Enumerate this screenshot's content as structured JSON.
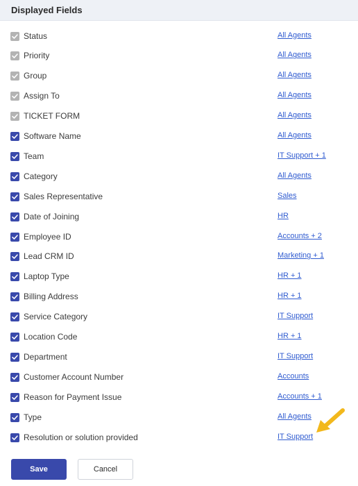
{
  "header": {
    "title": "Displayed Fields"
  },
  "fields": [
    {
      "label": "Status",
      "link": "All Agents",
      "locked": true
    },
    {
      "label": "Priority",
      "link": "All Agents",
      "locked": true
    },
    {
      "label": "Group",
      "link": "All Agents",
      "locked": true
    },
    {
      "label": "Assign To",
      "link": "All Agents",
      "locked": true
    },
    {
      "label": "TICKET FORM",
      "link": "All Agents",
      "locked": true
    },
    {
      "label": "Software Name",
      "link": "All Agents",
      "locked": false
    },
    {
      "label": "Team",
      "link": "IT Support + 1",
      "locked": false
    },
    {
      "label": "Category",
      "link": "All Agents",
      "locked": false
    },
    {
      "label": "Sales Representative",
      "link": "Sales",
      "locked": false
    },
    {
      "label": "Date of Joining",
      "link": "HR",
      "locked": false
    },
    {
      "label": "Employee ID",
      "link": "Accounts + 2",
      "locked": false
    },
    {
      "label": "Lead CRM ID",
      "link": "Marketing + 1",
      "locked": false
    },
    {
      "label": "Laptop Type",
      "link": "HR + 1",
      "locked": false
    },
    {
      "label": "Billing Address",
      "link": "HR + 1",
      "locked": false
    },
    {
      "label": "Service Category",
      "link": "IT Support",
      "locked": false
    },
    {
      "label": "Location Code",
      "link": "HR + 1",
      "locked": false
    },
    {
      "label": "Department",
      "link": "IT Support",
      "locked": false
    },
    {
      "label": "Customer Account Number",
      "link": "Accounts",
      "locked": false
    },
    {
      "label": "Reason for Payment Issue",
      "link": "Accounts + 1",
      "locked": false
    },
    {
      "label": "Type",
      "link": "All Agents",
      "locked": false
    },
    {
      "label": "Resolution or solution provided",
      "link": "IT Support",
      "locked": false
    }
  ],
  "footer": {
    "save_label": "Save",
    "cancel_label": "Cancel"
  },
  "colors": {
    "accent": "#3949ab",
    "locked_checkbox": "#b3b3b3",
    "link": "#2f5bd0",
    "annotation_arrow": "#f2b81c"
  }
}
